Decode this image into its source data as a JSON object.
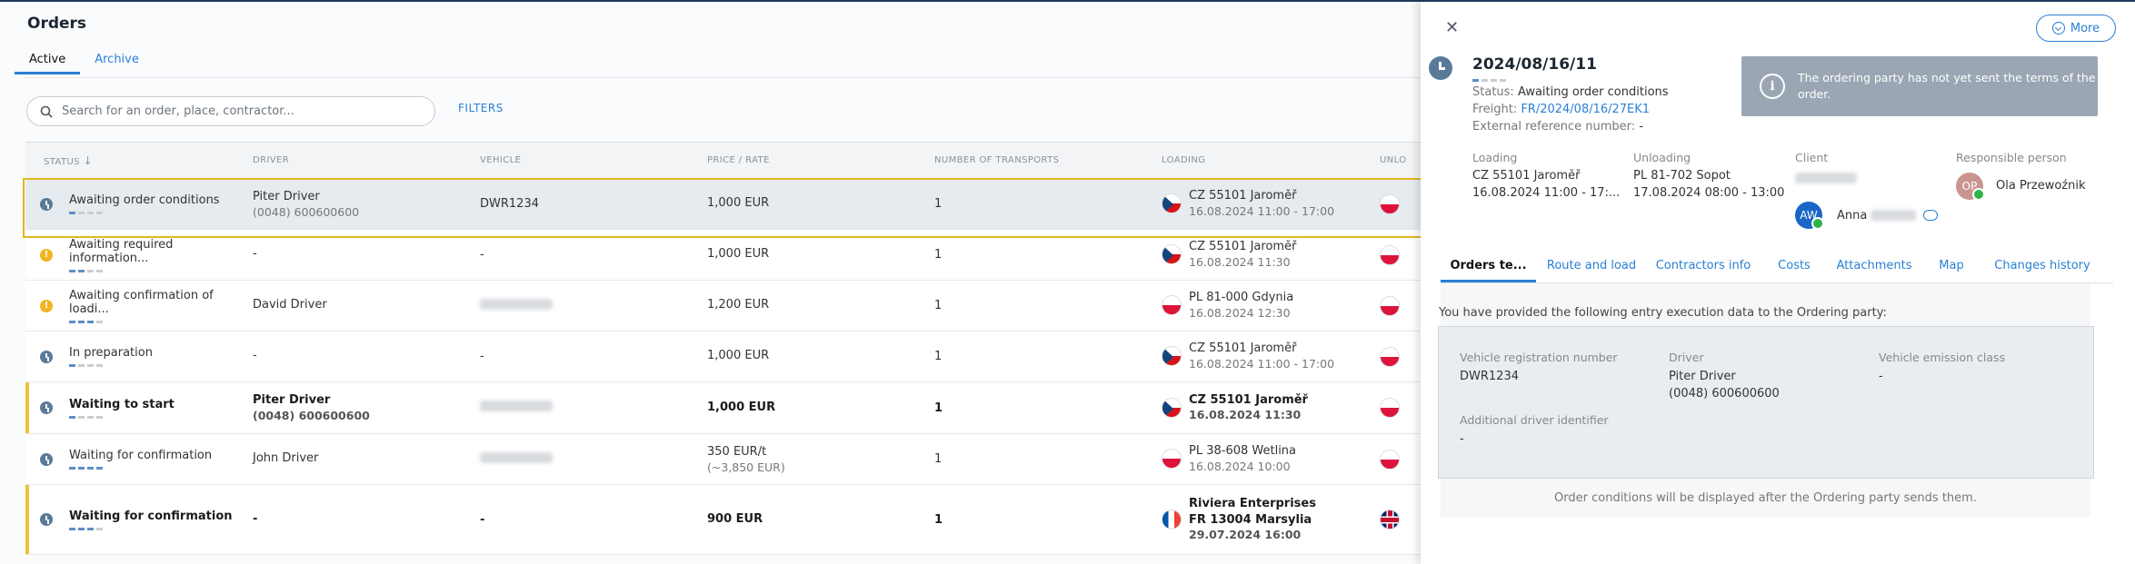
{
  "page": {
    "title": "Orders",
    "tabs": [
      {
        "label": "Active"
      },
      {
        "label": "Archive"
      }
    ]
  },
  "search": {
    "placeholder": "Search for an order, place, contractor...",
    "filters_label": "FILTERS"
  },
  "table": {
    "columns": [
      "STATUS",
      "DRIVER",
      "VEHICLE",
      "PRICE / RATE",
      "NUMBER OF TRANSPORTS",
      "LOADING",
      "UNLO"
    ],
    "rows": [
      {
        "status": "Awaiting order conditions",
        "icon": "clock-icon",
        "progress": 1,
        "driver": "Piter Driver",
        "driver_phone": "(0048) 600600600",
        "vehicle": "DWR1234",
        "price": "1,000 EUR",
        "price_sub": "",
        "transports": "1",
        "loading_flag": "CZ",
        "loading_place": "CZ 55101 Jaroměř",
        "loading_date": "16.08.2024 11:00 - 17:00",
        "unloading_flag": "PL"
      },
      {
        "status": "Awaiting required information...",
        "icon": "warning-icon",
        "progress": 2,
        "driver": "-",
        "driver_phone": "",
        "vehicle": "-",
        "price": "1,000 EUR",
        "price_sub": "",
        "transports": "1",
        "loading_flag": "CZ",
        "loading_place": "CZ 55101 Jaroměř",
        "loading_date": "16.08.2024 11:30",
        "unloading_flag": "PL"
      },
      {
        "status": "Awaiting confirmation of loadi...",
        "icon": "warning-icon",
        "progress": 3,
        "driver": "David Driver",
        "driver_phone": "",
        "vehicle": "",
        "price": "1,200 EUR",
        "price_sub": "",
        "transports": "1",
        "loading_flag": "PL",
        "loading_place": "PL 81-000 Gdynia",
        "loading_date": "16.08.2024 12:30",
        "unloading_flag": "PL"
      },
      {
        "status": "In preparation",
        "icon": "clock-icon",
        "progress": 1,
        "driver": "-",
        "driver_phone": "",
        "vehicle": "-",
        "price": "1,000 EUR",
        "price_sub": "",
        "transports": "1",
        "loading_flag": "CZ",
        "loading_place": "CZ 55101 Jaroměř",
        "loading_date": "16.08.2024 11:00 - 17:00",
        "unloading_flag": "PL"
      },
      {
        "status": "Waiting to start",
        "icon": "clock-icon",
        "progress": 1,
        "driver": "Piter Driver",
        "driver_phone": "(0048) 600600600",
        "vehicle": "",
        "price": "1,000 EUR",
        "price_sub": "",
        "transports": "1",
        "loading_flag": "CZ",
        "loading_place": "CZ 55101 Jaroměř",
        "loading_date": "16.08.2024 11:30",
        "unloading_flag": "PL"
      },
      {
        "status": "Waiting for confirmation",
        "icon": "clock-icon",
        "progress": 4,
        "driver": "John Driver",
        "driver_phone": "",
        "vehicle": "",
        "price": "350 EUR/t",
        "price_sub": "(~3,850 EUR)",
        "transports": "1",
        "loading_flag": "PL",
        "loading_place": "PL 38-608 Wetlina",
        "loading_date": "16.08.2024 10:00",
        "unloading_flag": "PL"
      },
      {
        "status": "Waiting for confirmation",
        "icon": "clock-icon",
        "progress": 3,
        "driver": "-",
        "driver_phone": "",
        "vehicle": "-",
        "price": "900 EUR",
        "price_sub": "",
        "transports": "1",
        "loading_flag": "FR",
        "loading_company": "Riviera Enterprises",
        "loading_place": "FR 13004 Marsylia",
        "loading_date": "29.07.2024 16:00",
        "unloading_flag": "GB"
      }
    ]
  },
  "panel": {
    "more_label": "More",
    "order_number": "2024/08/16/11",
    "status_label": "Status:",
    "status_value": "Awaiting order conditions",
    "freight_label": "Freight:",
    "freight_value": "FR/2024/08/16/27EK1",
    "extref_label": "External reference number:",
    "extref_value": "-",
    "info_message": "The ordering party has not yet sent the terms of the order.",
    "loading": {
      "label": "Loading",
      "place": "CZ 55101 Jaroměř",
      "date": "16.08.2024 11:00 - 17:..."
    },
    "unloading": {
      "label": "Unloading",
      "place": "PL 81-702 Sopot",
      "date": "17.08.2024 08:00 - 13:00"
    },
    "client": {
      "label": "Client",
      "contact_initials": "AW",
      "contact_name": "Anna"
    },
    "responsible": {
      "label": "Responsible person",
      "initials": "OP",
      "name": "Ola Przewoźnik"
    },
    "tabs": [
      {
        "label": "Orders te..."
      },
      {
        "label": "Route and load"
      },
      {
        "label": "Contractors info"
      },
      {
        "label": "Costs"
      },
      {
        "label": "Attachments"
      },
      {
        "label": "Map"
      },
      {
        "label": "Changes history"
      }
    ],
    "intro": "You have provided the following entry execution data to the Ordering party:",
    "exec": {
      "vehicle_reg_label": "Vehicle registration number",
      "vehicle_reg_value": "DWR1234",
      "driver_label": "Driver",
      "driver_name": "Piter Driver",
      "driver_phone": "(0048) 600600600",
      "emission_label": "Vehicle emission class",
      "emission_value": "-",
      "add_driver_label": "Additional driver identifier",
      "add_driver_value": "-"
    },
    "footer": "Order conditions will be displayed after the Ordering party sends them."
  },
  "colors": {
    "accent": "#2a7fd4",
    "row_accent": "#f2c037",
    "selection": "#e0b820",
    "status_clock": "#5a7a99",
    "status_warning": "#f0b520"
  }
}
